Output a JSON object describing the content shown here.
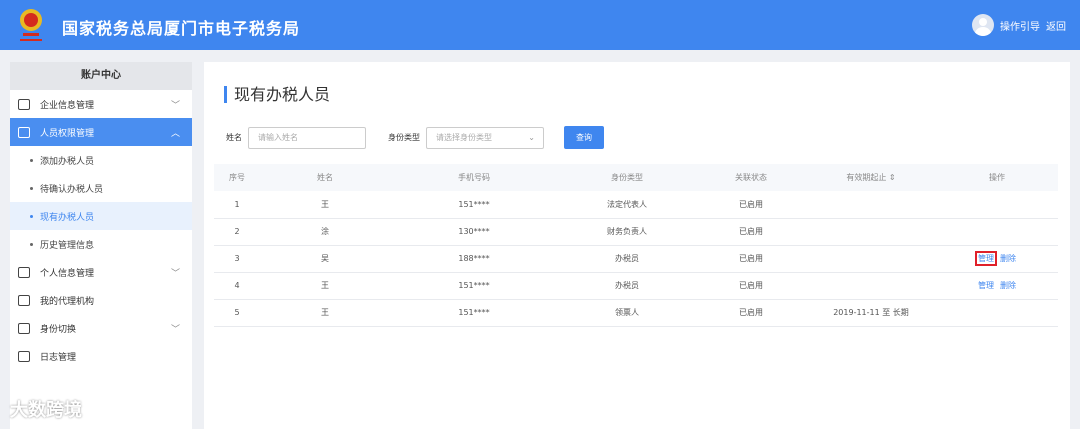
{
  "header": {
    "title": "国家税务总局厦门市电子税务局",
    "guide": "操作引导",
    "back": "返回"
  },
  "sidebar": {
    "title": "账户中心",
    "items": [
      {
        "label": "企业信息管理",
        "type": "group"
      },
      {
        "label": "人员权限管理",
        "type": "group-open"
      },
      {
        "label": "添加办税人员",
        "type": "sub"
      },
      {
        "label": "待确认办税人员",
        "type": "sub"
      },
      {
        "label": "现有办税人员",
        "type": "sub-current"
      },
      {
        "label": "历史管理信息",
        "type": "sub"
      },
      {
        "label": "个人信息管理",
        "type": "group"
      },
      {
        "label": "我的代理机构",
        "type": "item"
      },
      {
        "label": "身份切换",
        "type": "group"
      },
      {
        "label": "日志管理",
        "type": "item"
      }
    ]
  },
  "main": {
    "title": "现有办税人员",
    "form": {
      "name_label": "姓名",
      "name_placeholder": "请输入姓名",
      "type_label": "身份类型",
      "type_placeholder": "请选择身份类型",
      "query": "查询"
    },
    "columns": [
      "序号",
      "姓名",
      "手机号码",
      "身份类型",
      "关联状态",
      "有效期起止 ⇕",
      "操作"
    ],
    "rows": [
      {
        "no": "1",
        "name": "王",
        "phone": "151****",
        "type": "法定代表人",
        "status": "已启用",
        "period": "",
        "actions": []
      },
      {
        "no": "2",
        "name": "涂",
        "phone": "130****",
        "type": "财务负责人",
        "status": "已启用",
        "period": "",
        "actions": []
      },
      {
        "no": "3",
        "name": "吴",
        "phone": "188****",
        "type": "办税员",
        "status": "已启用",
        "period": "",
        "actions": [
          "管理",
          "删除"
        ]
      },
      {
        "no": "4",
        "name": "王",
        "phone": "151****",
        "type": "办税员",
        "status": "已启用",
        "period": "",
        "actions": [
          "管理",
          "删除"
        ]
      },
      {
        "no": "5",
        "name": "王",
        "phone": "151****",
        "type": "领票人",
        "status": "已启用",
        "period": "2019-11-11 至 长期",
        "actions": []
      }
    ]
  },
  "watermark": "大数跨境"
}
